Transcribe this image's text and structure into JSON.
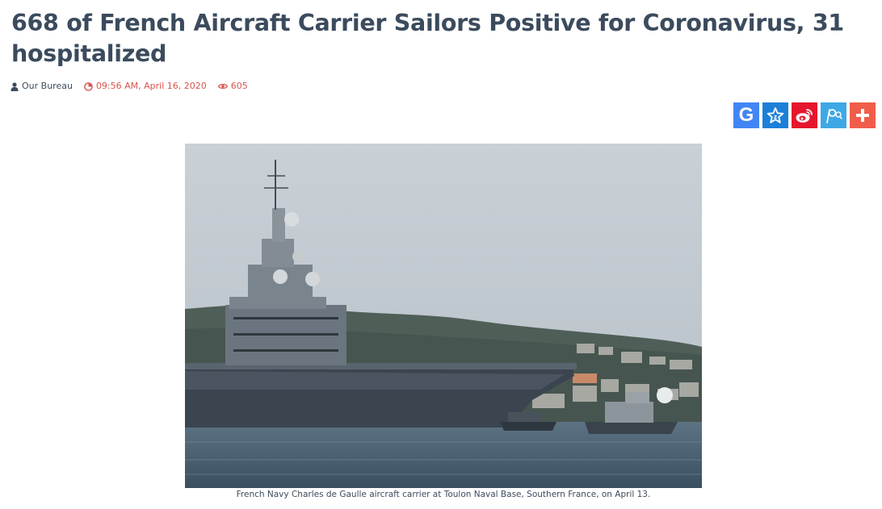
{
  "article": {
    "title": "668 of French Aircraft Carrier Sailors Positive for Coronavirus, 31 hospitalized",
    "meta": {
      "author": "Our Bureau",
      "datetime": "09:56 AM, April 16, 2020",
      "views": "605",
      "icons": [
        "user-icon",
        "clock-icon",
        "eye-icon"
      ]
    },
    "share_buttons": [
      {
        "name": "google-share",
        "icon": "google-icon",
        "color": "#4285f4"
      },
      {
        "name": "favorite-share",
        "icon": "star-icon",
        "color": "#1e7fd8"
      },
      {
        "name": "weibo-share",
        "icon": "weibo-icon",
        "color": "#e6162d"
      },
      {
        "name": "pocket-share",
        "icon": "pocket-icon",
        "color": "#3ea8e6"
      },
      {
        "name": "more-share",
        "icon": "plus-icon",
        "color": "#f05d4a"
      }
    ],
    "image": {
      "caption": "French Navy Charles de Gaulle aircraft carrier at Toulon Naval Base, Southern France, on April 13."
    }
  }
}
